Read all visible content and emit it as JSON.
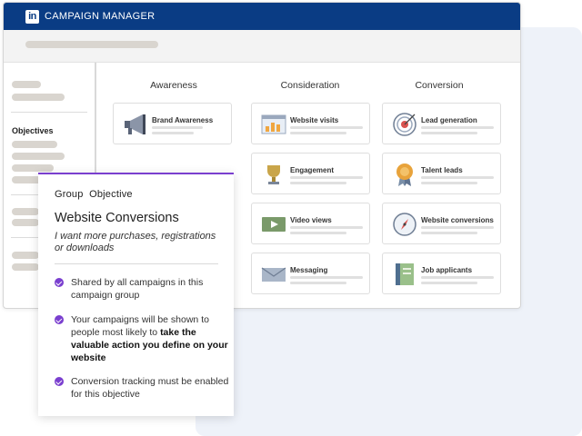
{
  "app": {
    "logo_text": "in",
    "title": "CAMPAIGN MANAGER"
  },
  "sidebar": {
    "heading": "Objectives"
  },
  "columns": [
    "Awareness",
    "Consideration",
    "Conversion"
  ],
  "objectives": {
    "awareness": [
      {
        "label": "Brand Awareness",
        "icon": "megaphone-icon"
      }
    ],
    "consideration": [
      {
        "label": "Website visits",
        "icon": "webpage-chart-icon"
      },
      {
        "label": "Engagement",
        "icon": "trophy-icon"
      },
      {
        "label": "Video views",
        "icon": "video-play-icon"
      },
      {
        "label": "Messaging",
        "icon": "envelope-icon"
      }
    ],
    "conversion": [
      {
        "label": "Lead generation",
        "icon": "target-icon"
      },
      {
        "label": "Talent leads",
        "icon": "award-badge-icon"
      },
      {
        "label": "Website conversions",
        "icon": "compass-icon"
      },
      {
        "label": "Job applicants",
        "icon": "notebook-icon"
      }
    ]
  },
  "popup": {
    "heading": "Group  Objective",
    "title": "Website Conversions",
    "subtitle": "I want more purchases, registrations or downloads",
    "bullets": [
      {
        "text": "Shared by all campaigns in this campaign group"
      },
      {
        "pre": "Your campaigns will be shown to people most likely to ",
        "bold": "take the valuable action you define on your website"
      },
      {
        "text": "Conversion tracking must be enabled for this objective"
      }
    ]
  },
  "colors": {
    "header": "#0a3c84",
    "accent": "#7a3fcf",
    "background_panel": "#eef2f9"
  }
}
